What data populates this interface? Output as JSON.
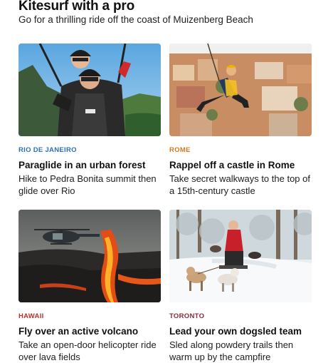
{
  "hero": {
    "title": "Kitesurf with a pro",
    "subtitle": "Go for a thrilling ride off the coast of Muizenberg Beach"
  },
  "cards": [
    {
      "location": "RIO DE JANEIRO",
      "location_color": "#2b6fb6",
      "title": "Paraglide in an urban forest",
      "description": "Hike to Pedra Bonita summit then glide over Rio"
    },
    {
      "location": "ROME",
      "location_color": "#d4781f",
      "title": "Rappel off a castle in Rome",
      "description": "Take secret walkways to the top of a 15th-century castle"
    },
    {
      "location": "HAWAII",
      "location_color": "#b8322c",
      "title": "Fly over an active volcano",
      "description": "Take an open-door helicopter ride over lava fields"
    },
    {
      "location": "TORONTO",
      "location_color": "#8b2a3a",
      "title": "Lead your own dogsled team",
      "description": "Sled along powdery trails then warm up by the campfire"
    }
  ]
}
